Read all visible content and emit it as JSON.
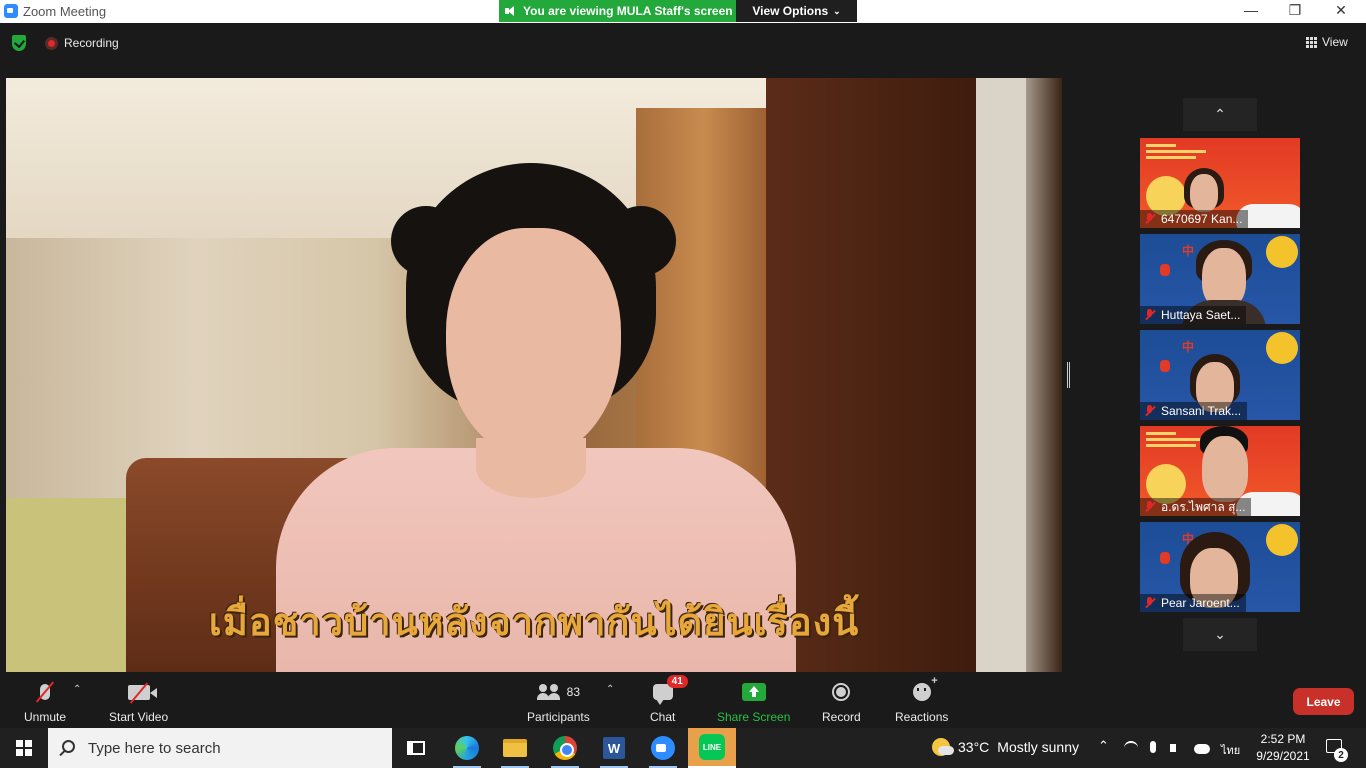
{
  "window": {
    "title": "Zoom Meeting",
    "viewing_banner": "You are viewing MULA Staff's screen",
    "view_options": "View Options",
    "minimize": "—",
    "maximize": "❐",
    "close": "✕"
  },
  "meeting_top": {
    "recording_label": "Recording",
    "view_label": "View"
  },
  "main_video": {
    "subtitle": "เมื่อชาวบ้านหลังจากพากันได้ยินเรื่องนี้"
  },
  "thumbnails": [
    {
      "name": "6470697 Kan...",
      "theme": "red"
    },
    {
      "name": "Huttaya Saet...",
      "theme": "blue"
    },
    {
      "name": "Sansani Trak...",
      "theme": "blue"
    },
    {
      "name": "อ.ดร.ไพศาล สุ...",
      "theme": "red"
    },
    {
      "name": "Pear Jaroent...",
      "theme": "blue"
    }
  ],
  "toolbar": {
    "unmute": "Unmute",
    "start_video": "Start Video",
    "participants": "Participants",
    "participants_count": "83",
    "chat": "Chat",
    "chat_badge": "41",
    "share_screen": "Share Screen",
    "record": "Record",
    "reactions": "Reactions",
    "leave": "Leave"
  },
  "taskbar": {
    "search_placeholder": "Type here to search",
    "weather_temp": "33°C",
    "weather_desc": "Mostly sunny",
    "language": "ไทย",
    "time": "2:52 PM",
    "date": "9/29/2021",
    "notification_count": "2",
    "line_app": "LINE"
  },
  "colors": {
    "share_green": "#23a93b",
    "leave_red": "#c8312a",
    "zoom_blue": "#2D8CFF"
  }
}
